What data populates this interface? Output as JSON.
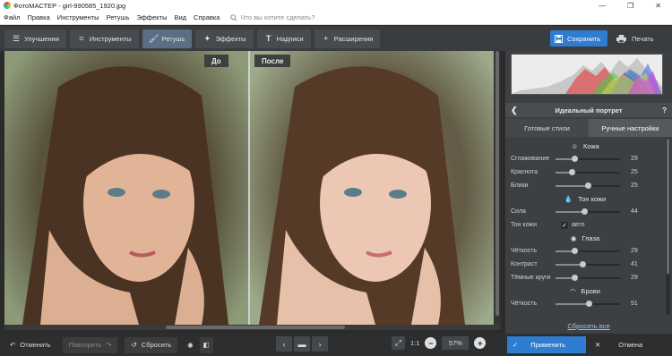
{
  "window": {
    "title": "ФотоМАСТЕР - girl-990585_1920.jpg",
    "minimize": "—",
    "maximize": "❐",
    "close": "✕"
  },
  "menu": {
    "items": [
      "Файл",
      "Правка",
      "Инструменты",
      "Ретушь",
      "Эффекты",
      "Вид",
      "Справка"
    ],
    "search_placeholder": "Что вы хотите сделать?"
  },
  "tabs": [
    {
      "label": "Улучшения",
      "icon": "sliders-icon",
      "active": false
    },
    {
      "label": "Инструменты",
      "icon": "crop-icon",
      "active": false
    },
    {
      "label": "Ретушь",
      "icon": "brush-icon",
      "active": true
    },
    {
      "label": "Эффекты",
      "icon": "wand-icon",
      "active": false
    },
    {
      "label": "Надписи",
      "icon": "text-icon",
      "active": false
    },
    {
      "label": "Расширения",
      "icon": "plus-icon",
      "active": false
    }
  ],
  "actions": {
    "save": "Сохранить",
    "print": "Печать"
  },
  "canvas": {
    "before_label": "До",
    "after_label": "После"
  },
  "panel": {
    "title": "Идеальный портрет",
    "help": "?",
    "tabs": [
      "Готовые стили",
      "Ручные настройки"
    ],
    "active_tab": 1,
    "sections": [
      {
        "title": "Кожа",
        "icon": "face-icon",
        "rows": [
          {
            "label": "Сглаживание",
            "value": 29,
            "max": 100
          },
          {
            "label": "Краснота",
            "value": 25,
            "max": 100
          },
          {
            "label": "Блики",
            "value": 25,
            "max": 50
          }
        ]
      },
      {
        "title": "Тон кожи",
        "icon": "drop-icon",
        "rows": [
          {
            "label": "Сила",
            "value": 44,
            "max": 100
          }
        ],
        "checkbox": {
          "label": "Тон кожи",
          "text": "авто",
          "checked": true
        }
      },
      {
        "title": "Глаза",
        "icon": "eye-icon",
        "rows": [
          {
            "label": "Чёткость",
            "value": 29,
            "max": 100
          },
          {
            "label": "Контраст",
            "value": 41,
            "max": 100
          },
          {
            "label": "Тёмные круги",
            "value": 29,
            "max": 100
          }
        ]
      },
      {
        "title": "Брови",
        "icon": "brow-icon",
        "rows": [
          {
            "label": "Чёткость",
            "value": 51,
            "max": 100
          }
        ]
      }
    ],
    "reset_all": "Сбросить все"
  },
  "bottom": {
    "undo": "Отменить",
    "redo": "Повторить",
    "reset": "Сбросить",
    "zoom_ratio": "1:1",
    "zoom_value": "57%",
    "apply": "Применить",
    "cancel": "Отмена"
  },
  "colors": {
    "accent": "#2f7dd1",
    "panel": "#3d4043",
    "toolbar": "#3a3d40"
  }
}
